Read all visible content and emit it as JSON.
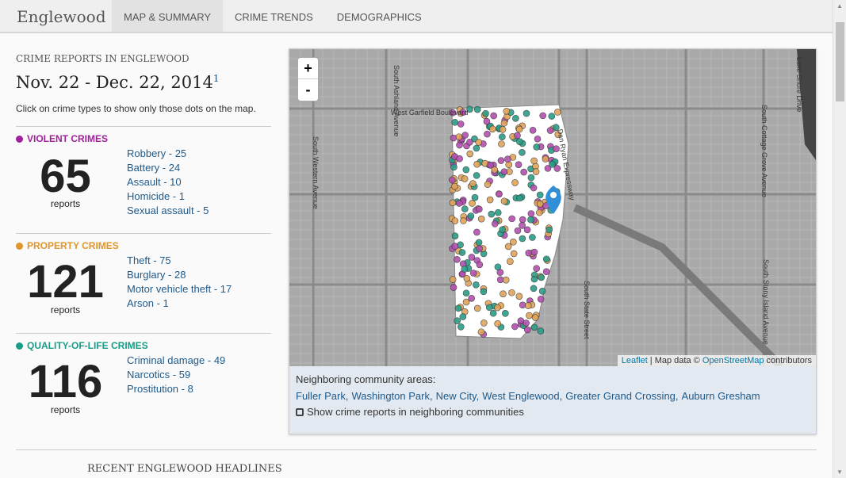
{
  "nav": {
    "brand": "Englewood",
    "tabs": [
      "MAP & SUMMARY",
      "CRIME TRENDS",
      "DEMOGRAPHICS"
    ]
  },
  "summary": {
    "kicker": "CRIME REPORTS IN ENGLEWOOD",
    "date": "Nov. 22 - Dec. 22, 2014",
    "footnote": "1",
    "hint": "Click on crime types to show only those dots on the map."
  },
  "sections": [
    {
      "title": "VIOLENT CRIMES",
      "color": "#a0219b",
      "total": "65",
      "unit": "reports",
      "items": [
        "Robbery - 25",
        "Battery - 24",
        "Assault - 10",
        "Homicide - 1",
        "Sexual assault - 5"
      ]
    },
    {
      "title": "PROPERTY CRIMES",
      "color": "#e0962c",
      "total": "121",
      "unit": "reports",
      "items": [
        "Theft - 75",
        "Burglary - 28",
        "Motor vehicle theft - 17",
        "Arson - 1"
      ]
    },
    {
      "title": "QUALITY-OF-LIFE CRIMES",
      "color": "#179d86",
      "total": "116",
      "unit": "reports",
      "items": [
        "Criminal damage - 49",
        "Narcotics - 59",
        "Prostitution - 8"
      ]
    }
  ],
  "map": {
    "zoom_in": "+",
    "zoom_out": "-",
    "attribution": {
      "leaflet": "Leaflet",
      "mid": " | Map data © ",
      "osm": "OpenStreetMap",
      "end": " contributors"
    },
    "streets": [
      "West Garfield Boulevard",
      "South Ashland Avenue",
      "South Western Avenue",
      "Dan Ryan Expressway",
      "South State Street",
      "South Cottage Grove Avenue",
      "South Stony Island Avenue",
      "Lake Shore Drive"
    ],
    "dot_colors": {
      "violent": "#b34fb0",
      "property": "#e0a45a",
      "quality": "#2a9d87"
    },
    "marker_color": "#2f8fd8"
  },
  "neighbors": {
    "label": "Neighboring community areas:",
    "areas": [
      "Fuller Park,",
      "Washington Park,",
      "New City,",
      "West Englewood,",
      "Greater Grand Crossing,",
      "Auburn Gresham"
    ],
    "checkbox": "Show crime reports in neighboring communities"
  },
  "footer": {
    "headline": "RECENT ENGLEWOOD HEADLINES"
  }
}
